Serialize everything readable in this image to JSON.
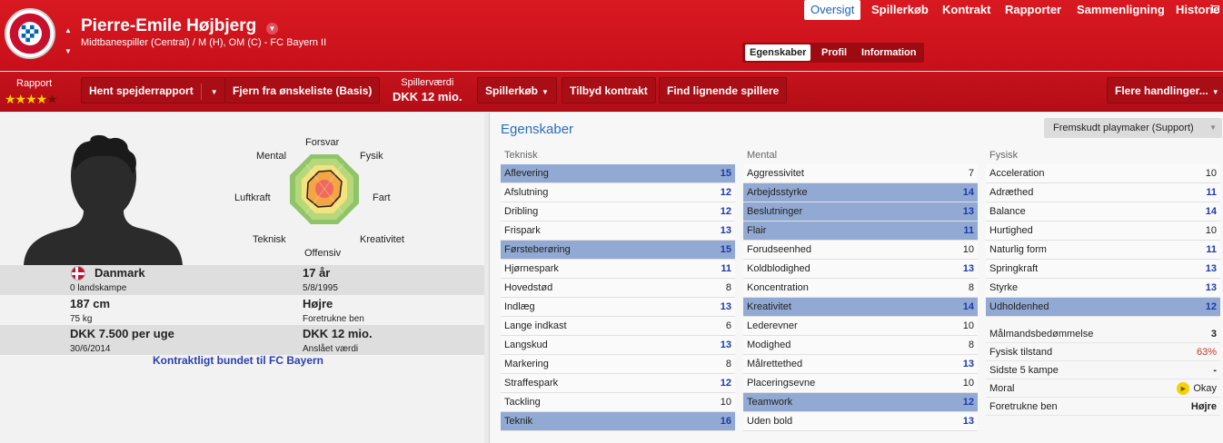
{
  "header": {
    "player_name": "Pierre-Emile Højbjerg",
    "subtitle": "Midtbanespiller (Central) / M (H), OM (C) - FC Bayern II",
    "club_badge_text": "FC BAYERN MÜNCHEN",
    "tabs": [
      {
        "label": "Oversigt",
        "active": true
      },
      {
        "label": "Spillerkøb",
        "active": false
      },
      {
        "label": "Kontrakt",
        "active": false
      },
      {
        "label": "Rapporter",
        "active": false
      },
      {
        "label": "Sammenligning",
        "active": false
      },
      {
        "label": "Historie",
        "active": false
      }
    ],
    "subtabs": [
      {
        "label": "Egenskaber",
        "active": true
      },
      {
        "label": "Profil",
        "active": false
      },
      {
        "label": "Information",
        "active": false
      }
    ]
  },
  "toolbar": {
    "rating_label": "Rapport",
    "stars_filled": 4,
    "stars_total": 5,
    "scout_report_btn": "Hent spejderrapport",
    "remove_shortlist_btn": "Fjern fra ønskeliste (Basis)",
    "value_label": "Spillerværdi",
    "value_amount": "DKK 12 mio.",
    "transfer_btn": "Spillerkøb",
    "offer_contract_btn": "Tilbyd kontrakt",
    "find_similar_btn": "Find lignende spillere",
    "more_actions_btn": "Flere handlinger..."
  },
  "radar": {
    "labels": [
      "Forsvar",
      "Fysik",
      "Fart",
      "Kreativitet",
      "Offensiv",
      "Teknisk",
      "Luftkraft",
      "Mental"
    ]
  },
  "info": {
    "nation": "Danmark",
    "caps": "0 landskampe",
    "age": "17 år",
    "dob": "5/8/1995",
    "height": "187 cm",
    "weight": "75 kg",
    "foot": "Højre",
    "foot_label": "Foretrukne ben",
    "wage": "DKK 7.500 per uge",
    "contract_end": "30/6/2014",
    "value": "DKK 12 mio.",
    "value_label": "Anslået værdi",
    "contract_link": "Kontraktligt bundet til FC Bayern"
  },
  "attributes": {
    "title": "Egenskaber",
    "role": "Fremskudt playmaker (Support)",
    "technical": {
      "heading": "Teknisk",
      "items": [
        {
          "name": "Aflevering",
          "value": "15",
          "key": true
        },
        {
          "name": "Afslutning",
          "value": "12",
          "key": false
        },
        {
          "name": "Dribling",
          "value": "12",
          "key": false
        },
        {
          "name": "Frispark",
          "value": "13",
          "key": false
        },
        {
          "name": "Førsteberøring",
          "value": "15",
          "key": true
        },
        {
          "name": "Hjørnespark",
          "value": "11",
          "key": false
        },
        {
          "name": "Hovedstød",
          "value": "8",
          "key": false
        },
        {
          "name": "Indlæg",
          "value": "13",
          "key": false
        },
        {
          "name": "Lange indkast",
          "value": "6",
          "key": false
        },
        {
          "name": "Langskud",
          "value": "13",
          "key": false
        },
        {
          "name": "Markering",
          "value": "8",
          "key": false
        },
        {
          "name": "Straffespark",
          "value": "12",
          "key": false
        },
        {
          "name": "Tackling",
          "value": "10",
          "key": false
        },
        {
          "name": "Teknik",
          "value": "16",
          "key": true
        }
      ]
    },
    "mental": {
      "heading": "Mental",
      "items": [
        {
          "name": "Aggressivitet",
          "value": "7",
          "key": false
        },
        {
          "name": "Arbejdsstyrke",
          "value": "14",
          "key": true
        },
        {
          "name": "Beslutninger",
          "value": "13",
          "key": true
        },
        {
          "name": "Flair",
          "value": "11",
          "key": true
        },
        {
          "name": "Forudseenhed",
          "value": "10",
          "key": false
        },
        {
          "name": "Koldblodighed",
          "value": "13",
          "key": false
        },
        {
          "name": "Koncentration",
          "value": "8",
          "key": false
        },
        {
          "name": "Kreativitet",
          "value": "14",
          "key": true
        },
        {
          "name": "Lederevner",
          "value": "10",
          "key": false
        },
        {
          "name": "Modighed",
          "value": "8",
          "key": false
        },
        {
          "name": "Målrettethed",
          "value": "13",
          "key": false
        },
        {
          "name": "Placeringsevne",
          "value": "10",
          "key": false
        },
        {
          "name": "Teamwork",
          "value": "12",
          "key": true
        },
        {
          "name": "Uden bold",
          "value": "13",
          "key": false
        }
      ]
    },
    "physical": {
      "heading": "Fysisk",
      "items": [
        {
          "name": "Acceleration",
          "value": "10",
          "key": false
        },
        {
          "name": "Adræthed",
          "value": "11",
          "key": false
        },
        {
          "name": "Balance",
          "value": "14",
          "key": false
        },
        {
          "name": "Hurtighed",
          "value": "10",
          "key": false
        },
        {
          "name": "Naturlig form",
          "value": "11",
          "key": false
        },
        {
          "name": "Springkraft",
          "value": "13",
          "key": false
        },
        {
          "name": "Styrke",
          "value": "13",
          "key": false
        },
        {
          "name": "Udholdenhed",
          "value": "12",
          "key": true
        }
      ]
    },
    "misc": [
      {
        "name": "Målmandsbedømmelse",
        "value": "3"
      },
      {
        "name": "Fysisk tilstand",
        "value": "63%"
      },
      {
        "name": "Sidste 5 kampe",
        "value": "-"
      },
      {
        "name": "Moral",
        "value": "Okay"
      },
      {
        "name": "Foretrukne ben",
        "value": "Højre"
      }
    ]
  },
  "colors": {
    "header_red": "#d81921",
    "highlight_blue": "#92aad3",
    "value_blue": "#1c3aa8",
    "link_blue": "#2a40b0"
  }
}
